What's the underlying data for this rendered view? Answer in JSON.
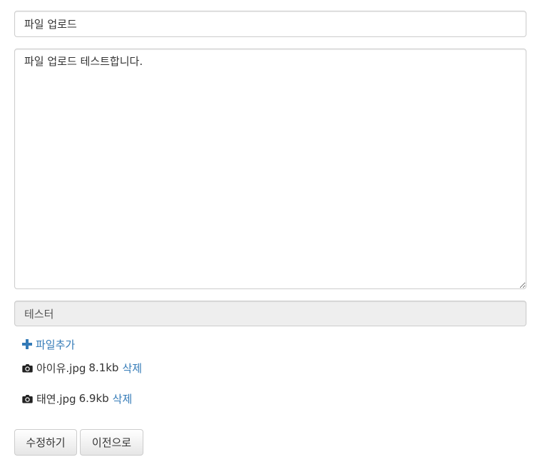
{
  "form": {
    "title_value": "파일 업로드",
    "content_value": "파일 업로드 테스트합니다.",
    "writer_value": "테스터"
  },
  "files": {
    "add_label": "파일추가",
    "items": [
      {
        "name": "아이유.jpg",
        "size": "8.1kb",
        "delete_label": "삭제"
      },
      {
        "name": "태연.jpg",
        "size": "6.9kb",
        "delete_label": "삭제"
      }
    ]
  },
  "buttons": {
    "submit_label": "수정하기",
    "back_label": "이전으로"
  },
  "colors": {
    "link": "#337ab7",
    "readonly_bg": "#eeeeee",
    "border": "#cccccc"
  }
}
